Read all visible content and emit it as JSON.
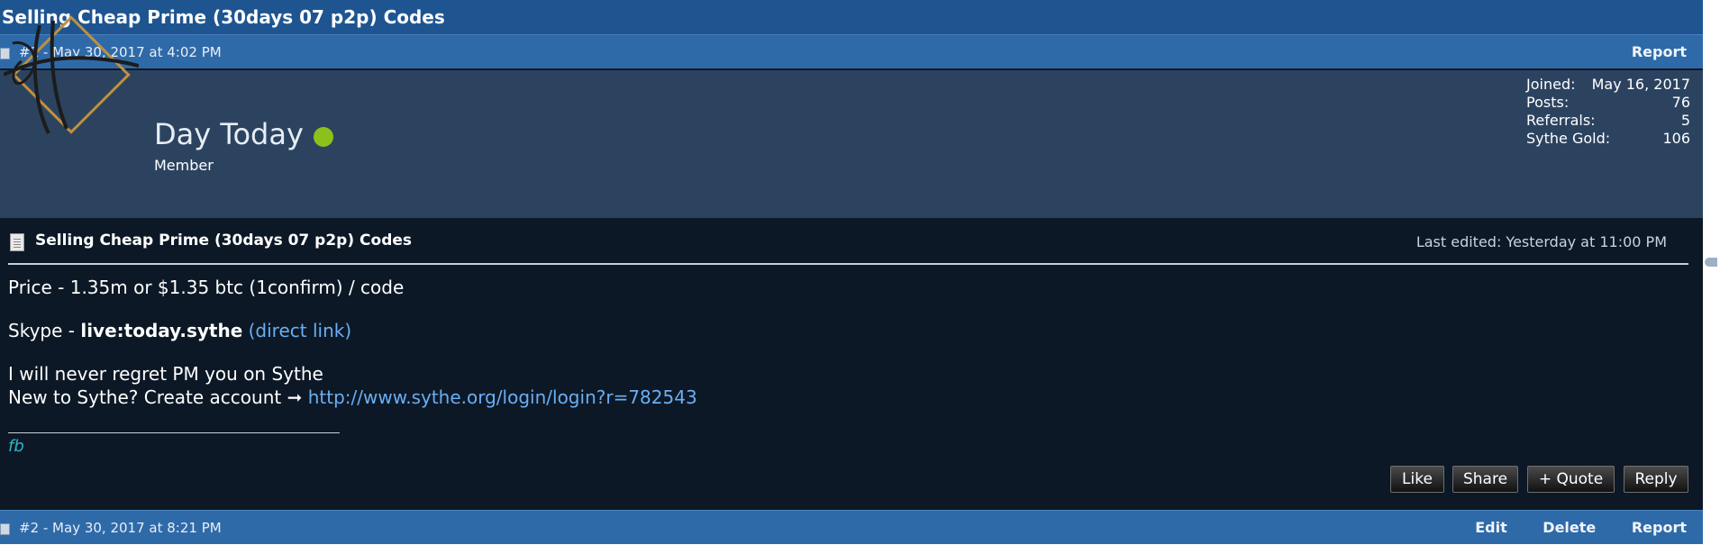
{
  "thread": {
    "title": "Selling Cheap Prime (30days 07 p2p) Codes"
  },
  "post": {
    "meta": "#1 - May 30, 2017 at 4:02 PM",
    "report_label": "Report",
    "user": {
      "name": "Day Today",
      "title": "Member",
      "online": true,
      "stats": [
        {
          "label": "Joined:",
          "value": "May 16, 2017"
        },
        {
          "label": "Posts:",
          "value": "76"
        },
        {
          "label": "Referrals:",
          "value": "5"
        },
        {
          "label": "Sythe Gold:",
          "value": "106"
        }
      ]
    },
    "title": "Selling Cheap Prime (30days 07 p2p) Codes",
    "last_edited": "Last edited: Yesterday at 11:00 PM",
    "body": {
      "price": "Price - 1.35m or $1.35 btc (1confirm) / code",
      "skype_prefix": "Skype - ",
      "skype_id": "live:today.sythe",
      "skype_link": "(direct link)",
      "never_regret": "I will never regret PM you on Sythe",
      "new_to_sythe": "New to Sythe? Create account ➞ ",
      "login_url": "http://www.sythe.org/login/login?r=782543"
    },
    "signature": "fb",
    "buttons": {
      "like": "Like",
      "share": "Share",
      "quote": "+ Quote",
      "reply": "Reply"
    }
  },
  "next_post": {
    "meta": "#2 - May 30, 2017 at 8:21 PM",
    "actions": [
      "Edit",
      "Delete",
      "Report"
    ]
  },
  "colors": {
    "header": "#1e5591",
    "postbar": "#2f6aa8",
    "userpanel": "#2c4360",
    "body": "#0d1826",
    "link": "#6aaef2",
    "online": "#8cc11b",
    "signature": "#2fb5c8"
  },
  "icons": [
    "post-doc-icon",
    "avatar-logo-icon",
    "online-status-icon",
    "post-title-doc-icon"
  ]
}
